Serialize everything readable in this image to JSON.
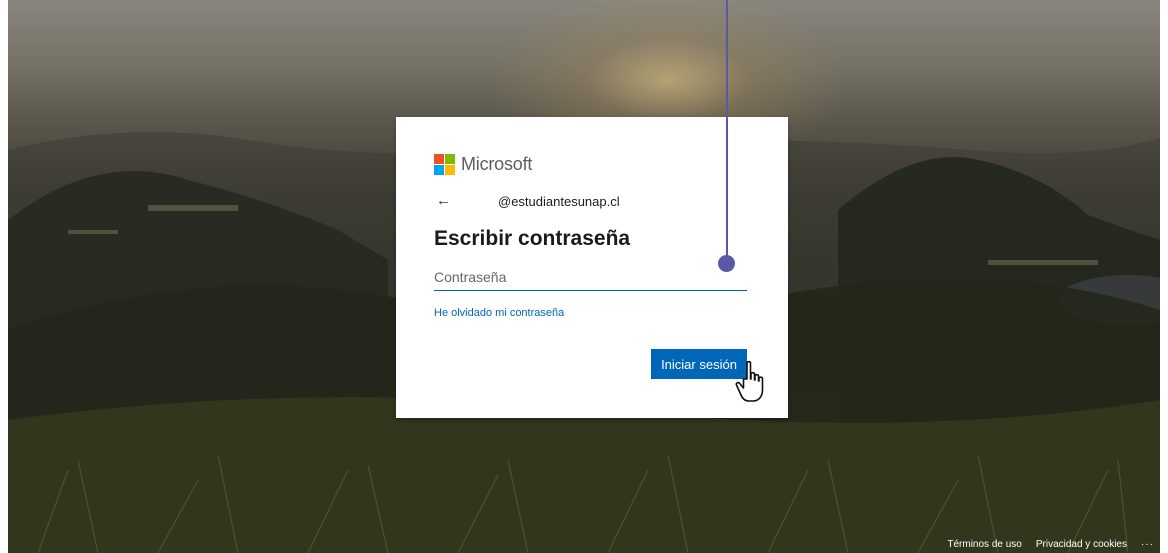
{
  "brand": {
    "name": "Microsoft",
    "logo_colors": [
      "#f25022",
      "#7fba00",
      "#00a4ef",
      "#ffb900"
    ]
  },
  "login_card": {
    "back_icon": "arrow-left-icon",
    "back_glyph": "←",
    "identity": "@estudiantesunap.cl",
    "title": "Escribir contraseña",
    "password_placeholder": "Contraseña",
    "forgot_link": "He olvidado mi contraseña",
    "signin_label": "Iniciar sesión"
  },
  "footer": {
    "terms": "Términos de uso",
    "privacy": "Privacidad y cookies",
    "more": "···"
  },
  "colors": {
    "accent": "#0067b8",
    "annotation": "#5b58a8"
  }
}
